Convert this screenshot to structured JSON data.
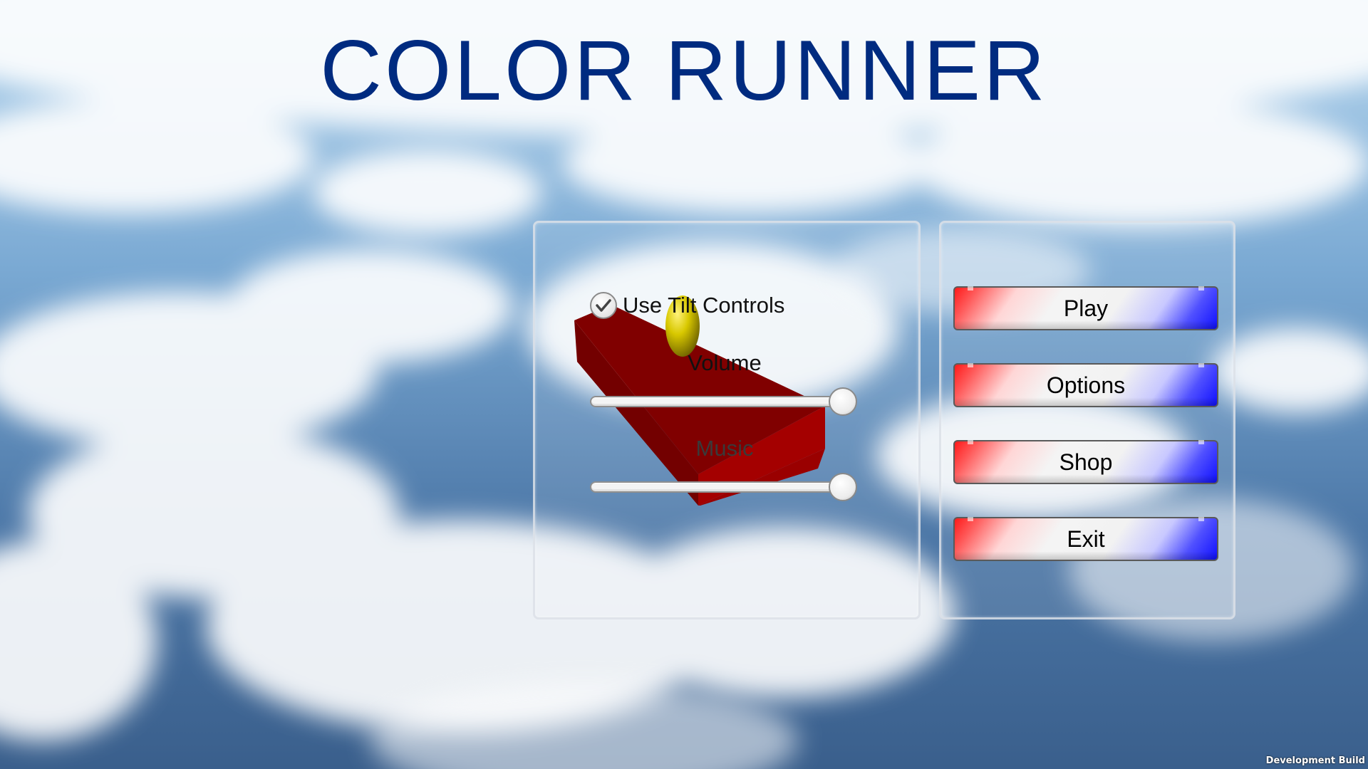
{
  "title": "COLOR RUNNER",
  "options": {
    "tilt_label": "Use Tilt Controls",
    "tilt_checked": true,
    "volume_label": "Volume",
    "volume_value": 1.0,
    "music_label": "Music",
    "music_value": 1.0
  },
  "menu": {
    "play_label": "Play",
    "options_label": "Options",
    "shop_label": "Shop",
    "exit_label": "Exit"
  },
  "colors": {
    "title": "#002b80",
    "button_left": "#ff1a1a",
    "button_right": "#1010ff",
    "block": "#a00000",
    "ball": "#d8c800"
  },
  "footer": {
    "build_label": "Development Build"
  }
}
